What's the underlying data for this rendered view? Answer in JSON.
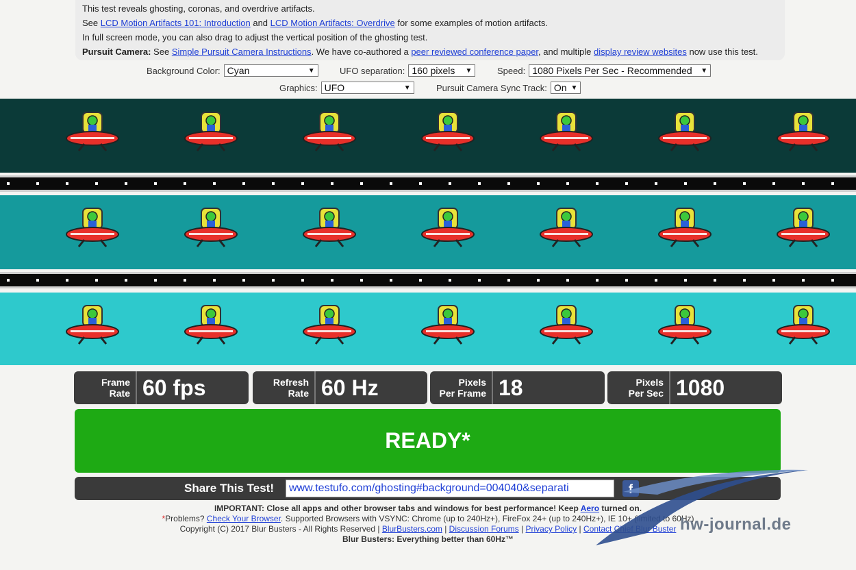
{
  "info": {
    "line1": "This test reveals ghosting, coronas, and overdrive artifacts.",
    "see": "See",
    "link1": "LCD Motion Artifacts 101: Introduction",
    "and": "and",
    "link2": "LCD Motion Artifacts: Overdrive",
    "line2_end": "for some examples of motion artifacts.",
    "line3": "In full screen mode, you can also drag to adjust the vertical position of the ghosting test.",
    "pc_label": "Pursuit Camera:",
    "pc_see": "See",
    "pc_link1": "Simple Pursuit Camera Instructions",
    "pc_mid": ". We have co-authored a",
    "pc_link2": "peer reviewed conference paper",
    "pc_mid2": ", and multiple",
    "pc_link3": "display review websites",
    "pc_end": "now use this test."
  },
  "controls": {
    "bg_label": "Background Color:",
    "bg_value": "Cyan",
    "sep_label": "UFO separation:",
    "sep_value": "160 pixels",
    "speed_label": "Speed:",
    "speed_value": "1080 Pixels Per Sec - Recommended",
    "graphics_label": "Graphics:",
    "graphics_value": "UFO",
    "sync_label": "Pursuit Camera Sync Track:",
    "sync_value": "On"
  },
  "lanes": [
    "#0b3a38",
    "#159a9c",
    "#2ec9cc"
  ],
  "stats": [
    {
      "label_line1": "Frame",
      "label_line2": "Rate",
      "value": "60 fps"
    },
    {
      "label_line1": "Refresh",
      "label_line2": "Rate",
      "value": "60 Hz"
    },
    {
      "label_line1": "Pixels",
      "label_line2": "Per Frame",
      "value": "18"
    },
    {
      "label_line1": "Pixels",
      "label_line2": "Per Sec",
      "value": "1080"
    }
  ],
  "ready": "READY*",
  "share": {
    "label": "Share This Test!",
    "url": "www.testufo.com/ghosting#background=004040&separati"
  },
  "footer": {
    "important": "IMPORTANT: Close all apps and other browser tabs and windows for best performance! Keep",
    "aero": "Aero",
    "important_end": "turned on.",
    "star": "*",
    "problems": "Problems?",
    "check_browser": "Check Your Browser",
    "supported": ". Supported Browsers with VSYNC: Chrome (up to 240Hz+), FireFox 24+ (up to 240Hz+), IE 10+ (limited to 60Hz)",
    "copyright": "Copyright (C) 2017 Blur Busters - All Rights Reserved |",
    "links": [
      "BlurBusters.com",
      "Discussion Forums",
      "Privacy Policy",
      "Contact Chief Blur Buster"
    ],
    "tagline": "Blur Busters: Everything better than 60Hz™"
  },
  "watermark": "hw-journal.de",
  "icons": {
    "ufo": "ufo-alien-icon",
    "facebook": "facebook-icon"
  }
}
